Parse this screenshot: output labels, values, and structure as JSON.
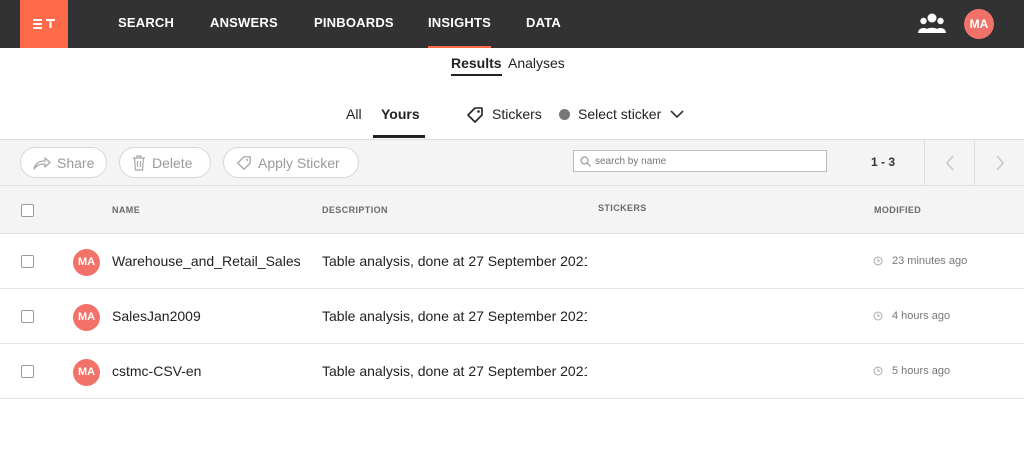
{
  "app": {
    "logo_text": "ST",
    "nav": [
      "SEARCH",
      "ANSWERS",
      "PINBOARDS",
      "INSIGHTS",
      "DATA"
    ],
    "active_nav": "INSIGHTS",
    "user_initials": "MA"
  },
  "subtabs": {
    "results": "Results",
    "analyses": "Analyses"
  },
  "filters": {
    "all": "All",
    "yours": "Yours",
    "stickers": "Stickers",
    "select_sticker": "Select sticker"
  },
  "toolbar": {
    "share": "Share",
    "delete": "Delete",
    "apply_sticker": "Apply Sticker",
    "search_placeholder": "search by name",
    "range": "1 - 3"
  },
  "table": {
    "headers": {
      "name": "NAME",
      "description": "DESCRIPTION",
      "stickers": "STICKERS",
      "modified": "MODIFIED"
    },
    "rows": [
      {
        "initials": "MA",
        "name": "Warehouse_and_Retail_Sales",
        "description": "Table analysis, done at 27 September 2021",
        "modified": "23 minutes ago"
      },
      {
        "initials": "MA",
        "name": "SalesJan2009",
        "description": "Table analysis, done at 27 September 2021",
        "modified": "4 hours ago"
      },
      {
        "initials": "MA",
        "name": "cstmc-CSV-en",
        "description": "Table analysis, done at 27 September 2021",
        "modified": "5 hours ago"
      }
    ]
  },
  "colors": {
    "accent": "#ff6b4a",
    "topbar": "#323232",
    "avatar": "#f2726a"
  }
}
